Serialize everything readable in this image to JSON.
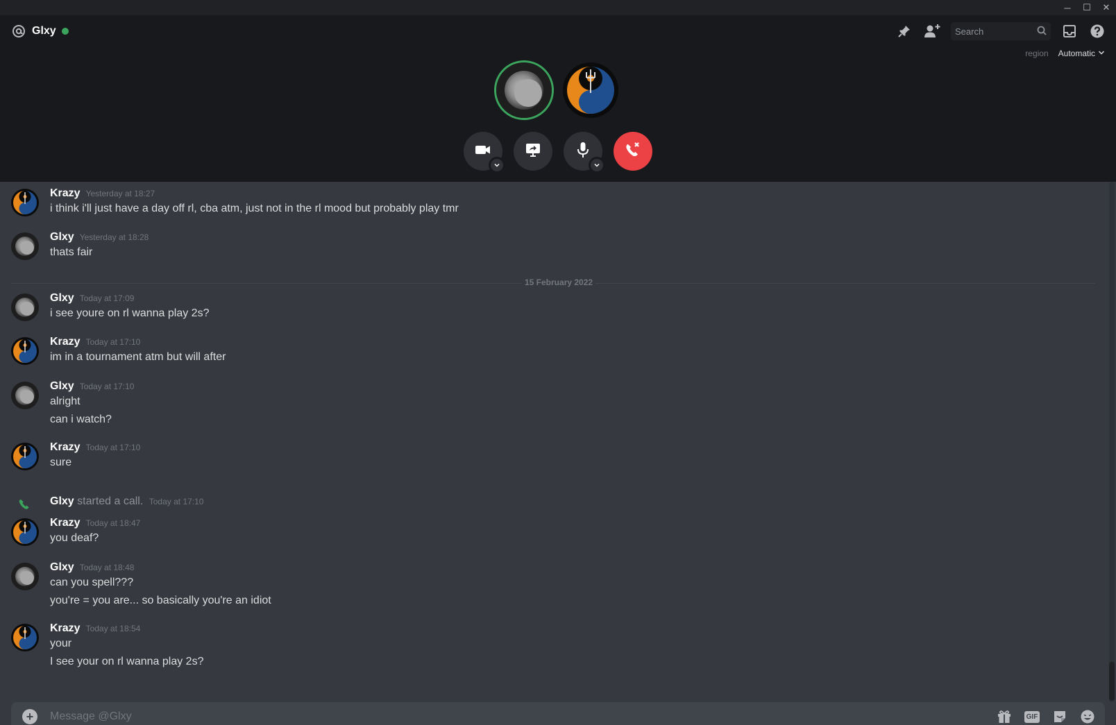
{
  "window": {
    "minimize": "─",
    "maximize": "☐",
    "close": "✕"
  },
  "header": {
    "channel": "Glxy",
    "search_placeholder": "Search",
    "region_label": "region",
    "region_value": "Automatic"
  },
  "divider": "15 February 2022",
  "messages": [
    {
      "author": "Krazy",
      "time": "Yesterday at 18:27",
      "lines": [
        "i think i'll just have a day off rl, cba atm, just not in the rl mood but probably play tmr"
      ]
    },
    {
      "author": "Glxy",
      "time": "Yesterday at 18:28",
      "lines": [
        "thats fair"
      ]
    },
    {
      "author": "Glxy",
      "time": "Today at 17:09",
      "lines": [
        "i see youre on rl wanna play 2s?"
      ]
    },
    {
      "author": "Krazy",
      "time": "Today at 17:10",
      "lines": [
        "im in a tournament atm but will after"
      ]
    },
    {
      "author": "Glxy",
      "time": "Today at 17:10",
      "lines": [
        "alright",
        "can i watch?"
      ]
    },
    {
      "author": "Krazy",
      "time": "Today at 17:10",
      "lines": [
        "sure"
      ]
    },
    {
      "author": "Krazy",
      "time": "Today at 18:47",
      "lines": [
        "you deaf?"
      ]
    },
    {
      "author": "Glxy",
      "time": "Today at 18:48",
      "lines": [
        "can you spell???",
        "you're = you are... so basically you're an idiot"
      ]
    },
    {
      "author": "Krazy",
      "time": "Today at 18:54",
      "lines": [
        "your",
        "I see your on rl wanna play 2s?"
      ]
    }
  ],
  "system": {
    "author": "Glxy",
    "action": "started a call.",
    "time": "Today at 17:10"
  },
  "composer": {
    "placeholder": "Message @Glxy",
    "gif": "GIF"
  },
  "colors": {
    "online": "#3ba55d",
    "hangup": "#ed4245",
    "background": "#36393f",
    "call_bg": "#18191c"
  }
}
